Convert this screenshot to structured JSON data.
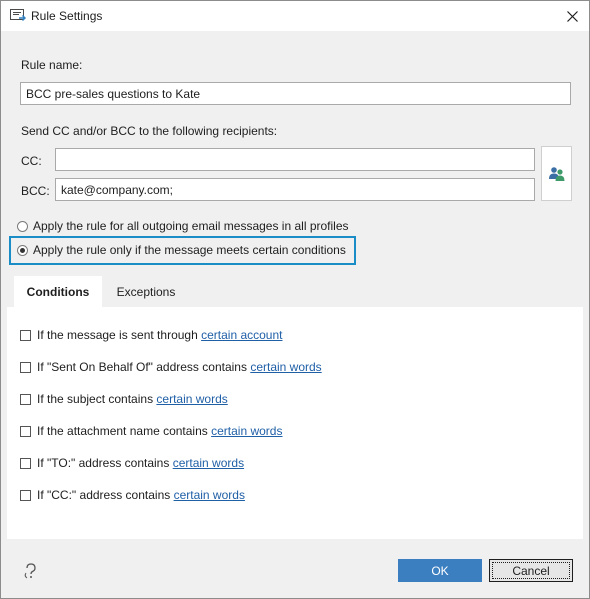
{
  "window": {
    "title": "Rule Settings"
  },
  "rule_name": {
    "label": "Rule name:",
    "value": "BCC pre-sales questions to Kate"
  },
  "recipients": {
    "heading": "Send CC and/or BCC to the following recipients:",
    "cc_label": "CC:",
    "cc_value": "",
    "bcc_label": "BCC:",
    "bcc_value": "kate@company.com;"
  },
  "apply_options": [
    {
      "label": "Apply the rule for all outgoing email messages in all profiles",
      "selected": false
    },
    {
      "label": "Apply the rule only if the message meets certain conditions",
      "selected": true
    }
  ],
  "tabs": [
    {
      "label": "Conditions",
      "active": true
    },
    {
      "label": "Exceptions",
      "active": false
    }
  ],
  "conditions": [
    {
      "text": "If the message is sent through ",
      "link": "certain account",
      "checked": false
    },
    {
      "text": "If \"Sent On Behalf Of\" address contains ",
      "link": "certain words",
      "checked": false
    },
    {
      "text": "If the subject contains ",
      "link": "certain words",
      "checked": false
    },
    {
      "text": "If the attachment name contains ",
      "link": "certain words",
      "checked": false
    },
    {
      "text": "If \"TO:\" address contains ",
      "link": "certain words",
      "checked": false
    },
    {
      "text": "If \"CC:\" address contains ",
      "link": "certain words",
      "checked": false
    }
  ],
  "buttons": {
    "ok": "OK",
    "cancel": "Cancel"
  },
  "icons": {
    "app": "rule-settings-icon",
    "close": "close-icon",
    "people": "address-book-icon",
    "help": "help-icon"
  },
  "colors": {
    "accent": "#3c7fc1",
    "highlight_border": "#1a8cc6",
    "link": "#1f5fa6",
    "dialog_bg": "#f0f0f0"
  }
}
